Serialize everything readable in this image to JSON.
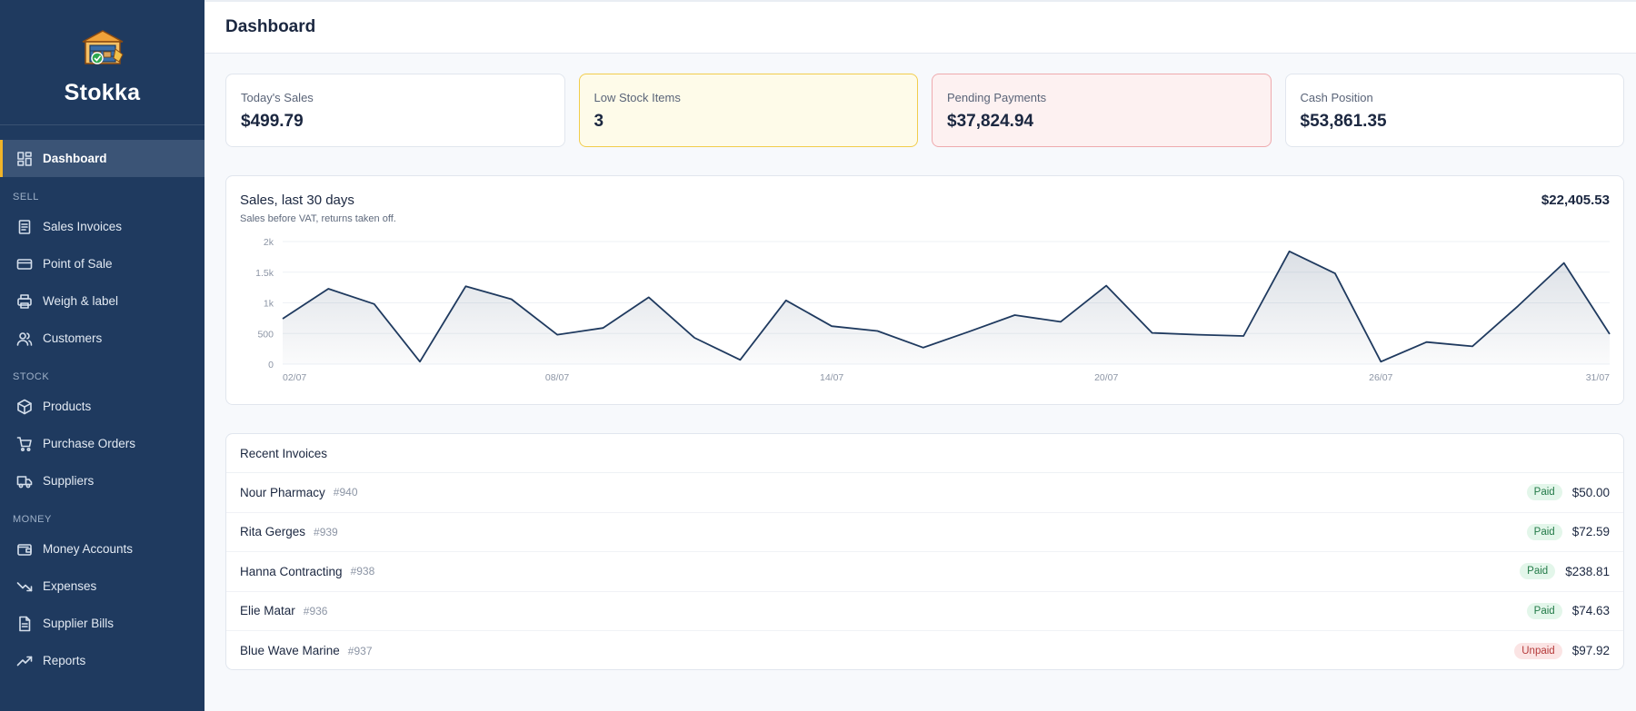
{
  "app": {
    "name": "Stokka"
  },
  "sidebar": {
    "primary": [
      {
        "label": "Dashboard",
        "icon": "dashboard-icon",
        "active": true
      }
    ],
    "sections": [
      {
        "label": "SELL",
        "items": [
          {
            "label": "Sales Invoices",
            "icon": "invoice-icon"
          },
          {
            "label": "Point of Sale",
            "icon": "card-icon"
          },
          {
            "label": "Weigh & label",
            "icon": "printer-icon"
          },
          {
            "label": "Customers",
            "icon": "users-icon"
          }
        ]
      },
      {
        "label": "STOCK",
        "items": [
          {
            "label": "Products",
            "icon": "box-icon"
          },
          {
            "label": "Purchase Orders",
            "icon": "cart-icon"
          },
          {
            "label": "Suppliers",
            "icon": "truck-icon"
          }
        ]
      },
      {
        "label": "MONEY",
        "items": [
          {
            "label": "Money Accounts",
            "icon": "wallet-icon"
          },
          {
            "label": "Expenses",
            "icon": "trending-down-icon"
          },
          {
            "label": "Supplier Bills",
            "icon": "document-icon"
          },
          {
            "label": "Reports",
            "icon": "trending-up-icon"
          }
        ]
      }
    ]
  },
  "header": {
    "title": "Dashboard"
  },
  "cards": [
    {
      "label": "Today's Sales",
      "value": "$499.79",
      "tone": "default"
    },
    {
      "label": "Low Stock Items",
      "value": "3",
      "tone": "warn"
    },
    {
      "label": "Pending Payments",
      "value": "$37,824.94",
      "tone": "danger"
    },
    {
      "label": "Cash Position",
      "value": "$53,861.35",
      "tone": "default"
    }
  ],
  "chart": {
    "title": "Sales, last 30 days",
    "subtitle": "Sales before VAT, returns taken off.",
    "total": "$22,405.53"
  },
  "chart_data": {
    "type": "area",
    "ylim": [
      0,
      2000
    ],
    "y_ticks": [
      0,
      500,
      1000,
      1500,
      2000
    ],
    "y_tick_labels": [
      "0",
      "500",
      "1k",
      "1.5k",
      "2k"
    ],
    "x_tick_labels": [
      "02/07",
      "08/07",
      "14/07",
      "20/07",
      "26/07",
      "31/07"
    ],
    "x_tick_index": [
      0,
      6,
      12,
      18,
      24,
      29
    ],
    "grid": true,
    "line_color": "#1f3a5f",
    "series": [
      {
        "values": [
          740,
          1230,
          980,
          40,
          1270,
          1060,
          480,
          590,
          1090,
          430,
          70,
          1040,
          620,
          540,
          270,
          530,
          800,
          690,
          1280,
          510,
          480,
          460,
          1840,
          1480,
          40,
          360,
          290,
          950,
          1650,
          490
        ]
      }
    ]
  },
  "invoices": {
    "title": "Recent Invoices",
    "rows": [
      {
        "name": "Nour Pharmacy",
        "number": "#940",
        "status": "Paid",
        "amount": "$50.00"
      },
      {
        "name": "Rita Gerges",
        "number": "#939",
        "status": "Paid",
        "amount": "$72.59"
      },
      {
        "name": "Hanna Contracting",
        "number": "#938",
        "status": "Paid",
        "amount": "$238.81"
      },
      {
        "name": "Elie Matar",
        "number": "#936",
        "status": "Paid",
        "amount": "$74.63"
      },
      {
        "name": "Blue Wave Marine",
        "number": "#937",
        "status": "Unpaid",
        "amount": "$97.92"
      }
    ]
  }
}
